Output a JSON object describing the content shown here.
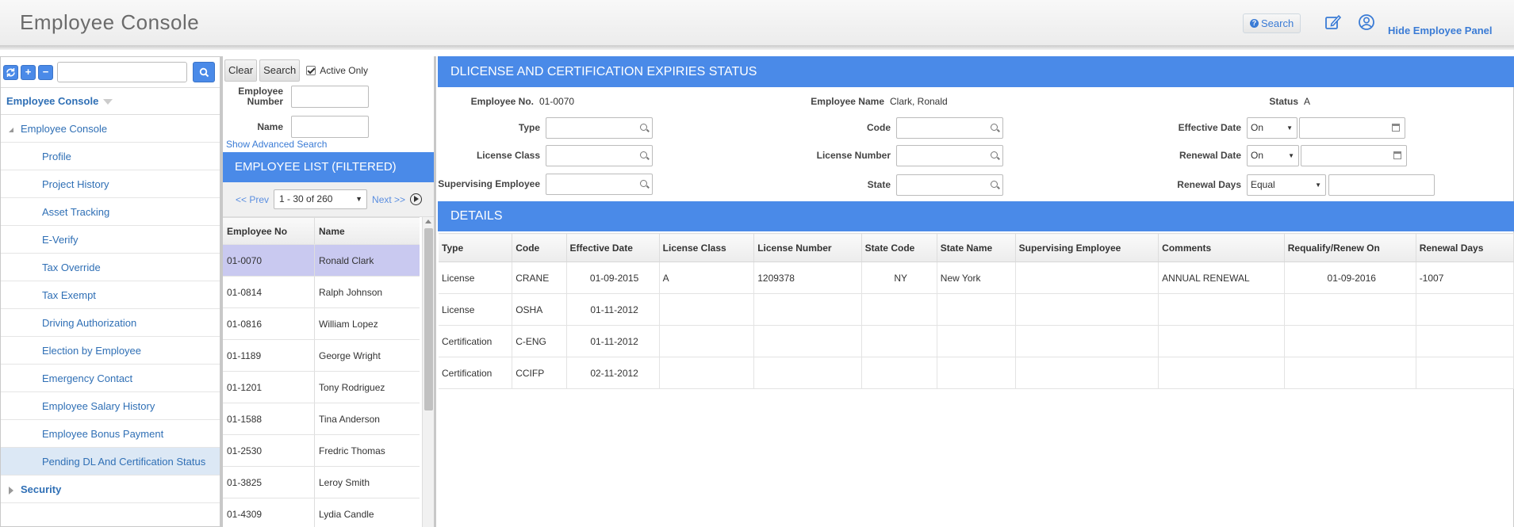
{
  "header": {
    "title": "Employee Console",
    "search_label": "Search",
    "hide_panel_label": "Hide Employee Panel"
  },
  "left": {
    "toolbar_icons": [
      "refresh-icon",
      "plus-icon",
      "minus-icon",
      "search-icon"
    ],
    "search_value": "",
    "dropdown_label": "Employee Console",
    "tree_root": "Employee Console",
    "items": [
      "Profile",
      "Project History",
      "Asset Tracking",
      "E-Verify",
      "Tax Override",
      "Tax Exempt",
      "Driving Authorization",
      "Election by Employee",
      "Emergency Contact",
      "Employee Salary History",
      "Employee Bonus Payment",
      "Pending DL And Certification Status"
    ],
    "active_item_index": 11,
    "security_label": "Security"
  },
  "middle": {
    "clear_label": "Clear",
    "search_label": "Search",
    "active_only_label": "Active Only",
    "active_only_checked": true,
    "employee_number_label": "Employee Number",
    "name_label": "Name",
    "advanced_search_label": "Show Advanced Search",
    "list_title": "EMPLOYEE LIST (FILTERED)",
    "prev_label": "<< Prev",
    "page_range": "1 - 30 of 260",
    "next_label": "Next >>",
    "columns": [
      "Employee No",
      "Name"
    ],
    "rows": [
      [
        "01-0070",
        "Ronald Clark"
      ],
      [
        "01-0814",
        "Ralph Johnson"
      ],
      [
        "01-0816",
        "William Lopez"
      ],
      [
        "01-1189",
        "George Wright"
      ],
      [
        "01-1201",
        "Tony Rodriguez"
      ],
      [
        "01-1588",
        "Tina Anderson"
      ],
      [
        "01-2530",
        "Fredric Thomas"
      ],
      [
        "01-3825",
        "Leroy Smith"
      ],
      [
        "01-4309",
        "Lydia Candle"
      ]
    ],
    "selected_row_index": 0
  },
  "main": {
    "section_title": "DLICENSE AND CERTIFICATION EXPIRIES STATUS",
    "employee_no_label": "Employee No.",
    "employee_no": "01-0070",
    "employee_name_label": "Employee Name",
    "employee_name": "Clark, Ronald",
    "status_label": "Status",
    "status": "A",
    "type_label": "Type",
    "code_label": "Code",
    "effective_date_label": "Effective Date",
    "effective_date_op": "On",
    "license_class_label": "License Class",
    "license_number_label": "License Number",
    "renewal_date_label": "Renewal Date",
    "renewal_date_op": "On",
    "supervising_employee_label": "Supervising Employee",
    "state_label": "State",
    "renewal_days_label": "Renewal Days",
    "renewal_days_op": "Equal",
    "details_title": "DETAILS",
    "columns": [
      "Type",
      "Code",
      "Effective Date",
      "License Class",
      "License Number",
      "State Code",
      "State Name",
      "Supervising Employee",
      "Comments",
      "Requalify/Renew On",
      "Renewal Days"
    ],
    "rows": [
      [
        "License",
        "CRANE",
        "01-09-2015",
        "A",
        "1209378",
        "NY",
        "New York",
        "",
        "ANNUAL RENEWAL",
        "01-09-2016",
        "-1007"
      ],
      [
        "License",
        "OSHA",
        "01-11-2012",
        "",
        "",
        "",
        "",
        "",
        "",
        "",
        ""
      ],
      [
        "Certification",
        "C-ENG",
        "01-11-2012",
        "",
        "",
        "",
        "",
        "",
        "",
        "",
        ""
      ],
      [
        "Certification",
        "CCIFP",
        "02-11-2012",
        "",
        "",
        "",
        "",
        "",
        "",
        "",
        ""
      ]
    ]
  },
  "colors": {
    "accent": "#4a8ae8",
    "link": "#2f6fb5",
    "selected_row": "#c9c9f0",
    "active_item": "#dce8f5"
  }
}
